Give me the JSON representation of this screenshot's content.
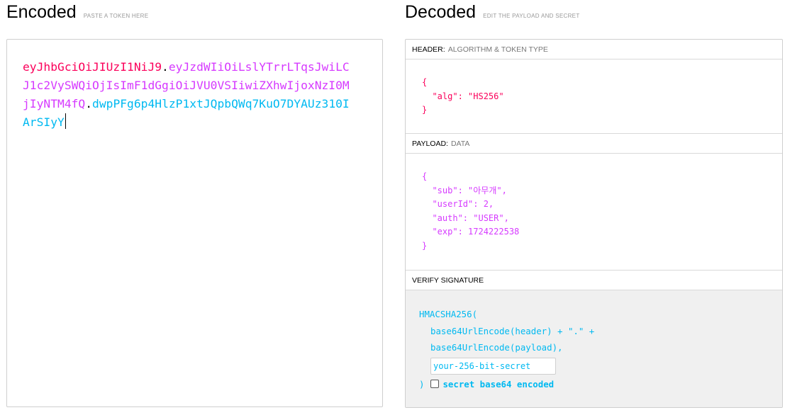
{
  "encoded": {
    "title": "Encoded",
    "hint": "PASTE A TOKEN HERE",
    "token_header": "eyJhbGciOiJIUzI1NiJ9",
    "token_payload": "eyJzdWIiOiLslYTrrLTqsJwiLCJ1c2VySWQiOjIsImF1dGgiOiJVU0VSIiwiZXhwIjoxNzI0MjIyNTM4fQ",
    "token_signature": "dwpPFg6p4HlzP1xtJQpbQWq7KuO7DYAUz310IArSIyY",
    "dot": "."
  },
  "decoded": {
    "title": "Decoded",
    "hint": "EDIT THE PAYLOAD AND SECRET",
    "header_section": {
      "label": "HEADER:",
      "sublabel": "ALGORITHM & TOKEN TYPE",
      "lines": [
        "{",
        "  \"alg\": \"HS256\"",
        "}"
      ]
    },
    "payload_section": {
      "label": "PAYLOAD:",
      "sublabel": "DATA",
      "lines": [
        "{",
        "  \"sub\": \"아무개\",",
        "  \"userId\": 2,",
        "  \"auth\": \"USER\",",
        "  \"exp\": 1724222538",
        "}"
      ]
    },
    "verify_section": {
      "label": "VERIFY SIGNATURE",
      "fn_open": "HMACSHA256(",
      "arg1": "base64UrlEncode(header) + \".\" +",
      "arg2": "base64UrlEncode(payload),",
      "secret_placeholder": "your-256-bit-secret",
      "fn_close": ")",
      "checkbox_label": "secret base64 encoded",
      "checkbox_checked": false
    }
  },
  "colors": {
    "header": "#fb015b",
    "payload": "#d63aff",
    "signature": "#00b9f1"
  }
}
